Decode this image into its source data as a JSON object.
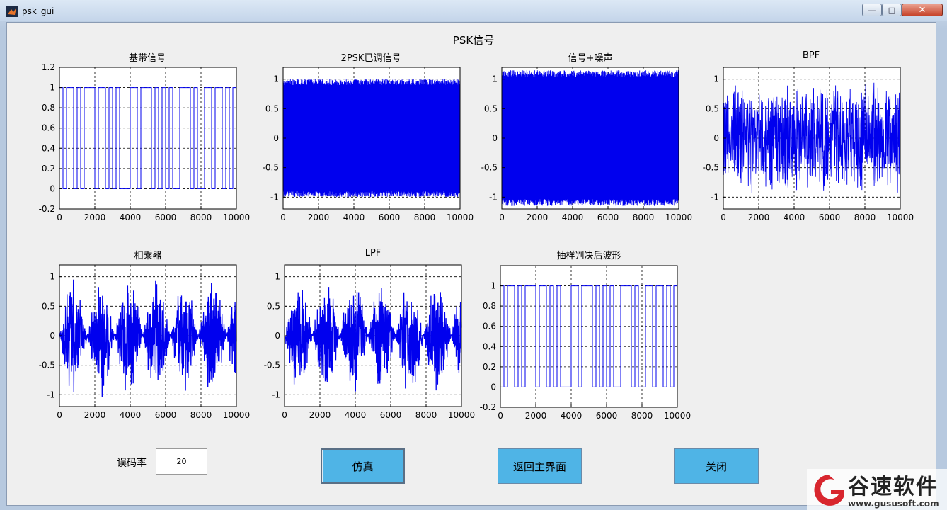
{
  "window": {
    "title": "psk_gui"
  },
  "page_title": "PSK信号",
  "controls": {
    "ber_label": "误码率",
    "ber_value": "20",
    "simulate_label": "仿真",
    "back_label": "返回主界面",
    "close_label": "关闭"
  },
  "watermark": {
    "name": "谷速软件",
    "url": "www.gususoft.com"
  },
  "colors": {
    "signal": "#0000ee",
    "button": "#4fb4e6"
  },
  "chart_data": [
    {
      "id": "baseband",
      "type": "line",
      "title": "基带信号",
      "style": "square",
      "xlim": [
        0,
        10000
      ],
      "ylim": [
        -0.2,
        1.2
      ],
      "xticks": [
        0,
        2000,
        4000,
        6000,
        8000,
        10000
      ],
      "yticks": [
        -0.2,
        0,
        0.2,
        0.4,
        0.6,
        0.8,
        1,
        1.2
      ],
      "grid": true,
      "bits": [
        1,
        0,
        1,
        1,
        0,
        1,
        0,
        1,
        1,
        1,
        0,
        1,
        1,
        0,
        1,
        0,
        1,
        0,
        0,
        0,
        1,
        1,
        0,
        1,
        1,
        1,
        0,
        1,
        0,
        1,
        0,
        1,
        0,
        0,
        1,
        1,
        1,
        0,
        1,
        0,
        0,
        1,
        1,
        0,
        1,
        1,
        0,
        1,
        0,
        1
      ]
    },
    {
      "id": "psk",
      "type": "line",
      "title": "2PSK已调信号",
      "style": "dense",
      "xlim": [
        0,
        10000
      ],
      "ylim": [
        -1.2,
        1.2
      ],
      "xticks": [
        0,
        2000,
        4000,
        6000,
        8000,
        10000
      ],
      "yticks": [
        -1,
        -0.5,
        0,
        0.5,
        1
      ],
      "grid": true,
      "envelope": {
        "min": -1,
        "max": 1
      }
    },
    {
      "id": "noisy",
      "type": "line",
      "title": "信号+噪声",
      "style": "dense",
      "xlim": [
        0,
        10000
      ],
      "ylim": [
        -1.2,
        1.2
      ],
      "xticks": [
        0,
        2000,
        4000,
        6000,
        8000,
        10000
      ],
      "yticks": [
        -1,
        -0.5,
        0,
        0.5,
        1
      ],
      "grid": true,
      "envelope": {
        "min": -1.15,
        "max": 1.15
      }
    },
    {
      "id": "bpf",
      "type": "line",
      "title": "BPF",
      "style": "noise",
      "xlim": [
        0,
        10000
      ],
      "ylim": [
        -1.2,
        1.2
      ],
      "xticks": [
        0,
        2000,
        4000,
        6000,
        8000,
        10000
      ],
      "yticks": [
        -1,
        -0.5,
        0,
        0.5,
        1
      ],
      "grid": true,
      "envelope": {
        "min": -1.05,
        "max": 1.05
      }
    },
    {
      "id": "mult",
      "type": "line",
      "title": "相乘器",
      "style": "bursts",
      "xlim": [
        0,
        10000
      ],
      "ylim": [
        -1.2,
        1.2
      ],
      "xticks": [
        0,
        2000,
        4000,
        6000,
        8000,
        10000
      ],
      "yticks": [
        -1,
        -0.5,
        0,
        0.5,
        1
      ],
      "grid": true,
      "envelope": {
        "min": -1.1,
        "max": 1.05
      }
    },
    {
      "id": "lpf",
      "type": "line",
      "title": "LPF",
      "style": "bursts",
      "xlim": [
        0,
        10000
      ],
      "ylim": [
        -1.2,
        1.2
      ],
      "xticks": [
        0,
        2000,
        4000,
        6000,
        8000,
        10000
      ],
      "yticks": [
        -1,
        -0.5,
        0,
        0.5,
        1
      ],
      "grid": true,
      "envelope": {
        "min": -1.1,
        "max": 1.05
      }
    },
    {
      "id": "decision",
      "type": "line",
      "title": "抽样判决后波形",
      "style": "square",
      "xlim": [
        0,
        10000
      ],
      "ylim": [
        -0.2,
        1.2
      ],
      "xticks": [
        0,
        2000,
        4000,
        6000,
        8000,
        10000
      ],
      "yticks": [
        -0.2,
        0,
        0.2,
        0.4,
        0.6,
        0.8,
        1
      ],
      "grid": true,
      "bits": [
        1,
        0,
        1,
        1,
        0,
        1,
        0,
        1,
        1,
        1,
        0,
        1,
        1,
        0,
        1,
        0,
        1,
        0,
        0,
        0,
        1,
        1,
        0,
        1,
        1,
        1,
        0,
        1,
        0,
        1,
        0,
        1,
        0,
        0,
        1,
        1,
        1,
        0,
        1,
        0,
        0,
        1,
        1,
        0,
        1,
        1,
        0,
        1,
        0,
        1
      ]
    }
  ]
}
